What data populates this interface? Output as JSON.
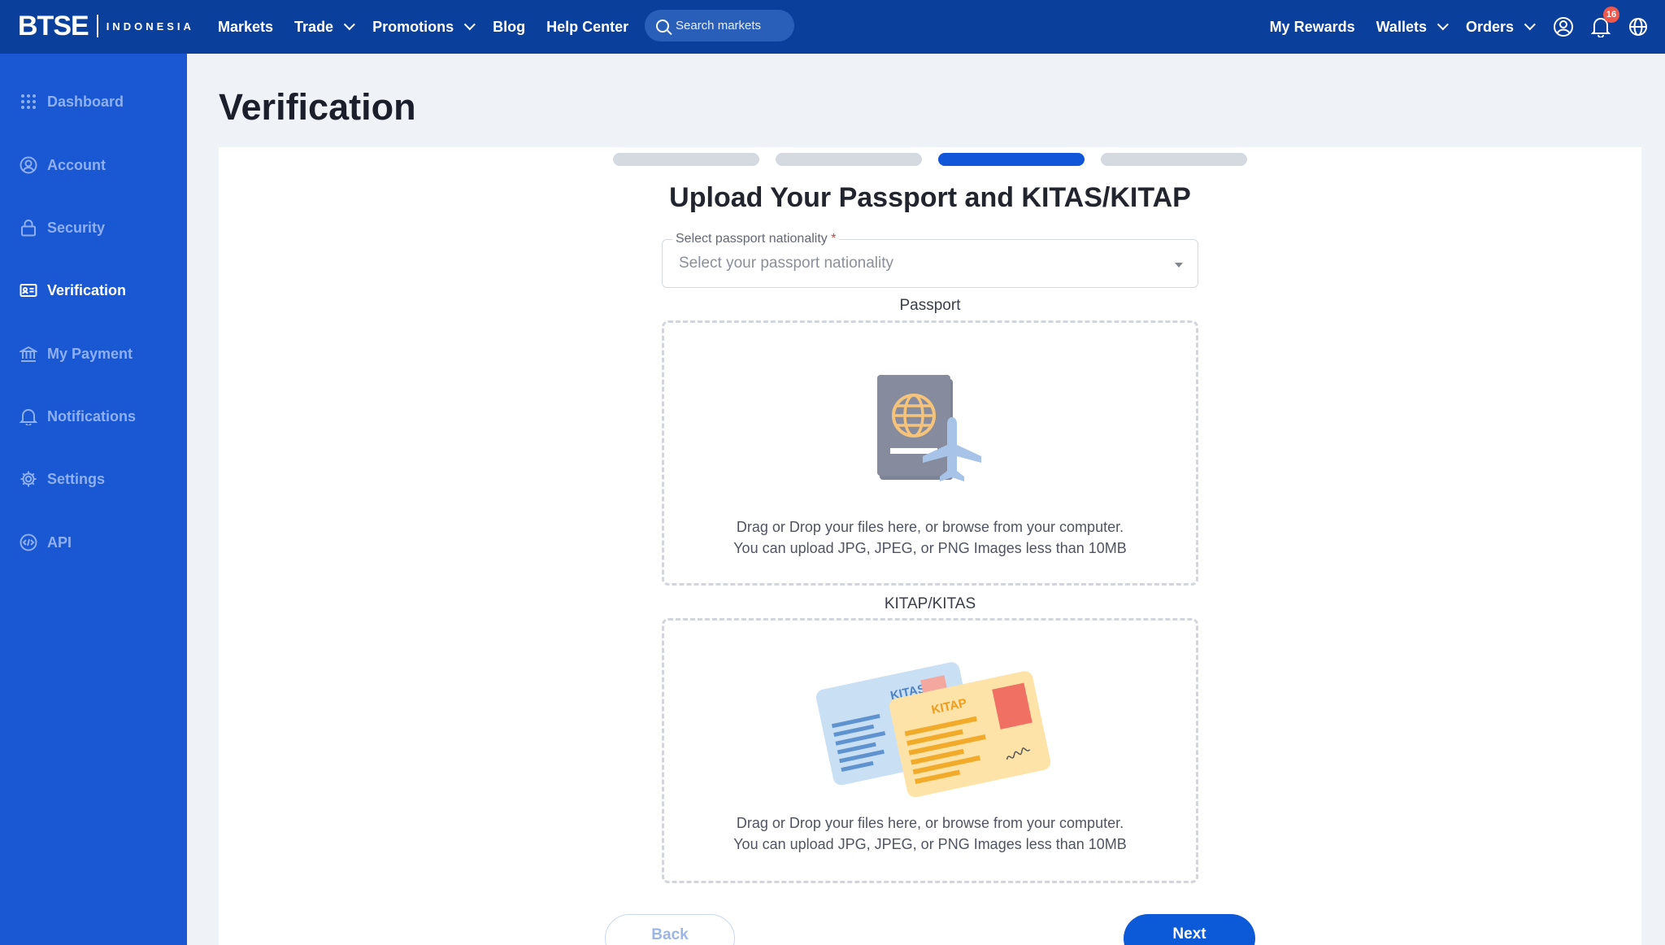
{
  "brand": {
    "name": "BTSE",
    "region": "INDONESIA"
  },
  "topnav": {
    "items": [
      {
        "label": "Markets",
        "has_caret": false
      },
      {
        "label": "Trade",
        "has_caret": true
      },
      {
        "label": "Promotions",
        "has_caret": true
      },
      {
        "label": "Blog",
        "has_caret": false
      },
      {
        "label": "Help Center",
        "has_caret": false
      }
    ],
    "search_placeholder": "Search markets",
    "right": {
      "rewards": "My Rewards",
      "wallets": "Wallets",
      "orders": "Orders",
      "notification_count": "16"
    }
  },
  "sidebar": {
    "items": [
      {
        "label": "Dashboard",
        "icon": "grid-icon",
        "active": false
      },
      {
        "label": "Account",
        "icon": "user-icon",
        "active": false
      },
      {
        "label": "Security",
        "icon": "lock-icon",
        "active": false
      },
      {
        "label": "Verification",
        "icon": "id-card-icon",
        "active": true
      },
      {
        "label": "My Payment",
        "icon": "bank-icon",
        "active": false
      },
      {
        "label": "Notifications",
        "icon": "bell-icon",
        "active": false
      },
      {
        "label": "Settings",
        "icon": "gear-icon",
        "active": false
      },
      {
        "label": "API",
        "icon": "code-icon",
        "active": false
      }
    ]
  },
  "main": {
    "page_title": "Verification",
    "progress": {
      "total_steps": 4,
      "current_step": 3
    },
    "heading": "Upload Your Passport and KITAS/KITAP",
    "nationality": {
      "label": "Select passport nationality",
      "required_mark": "*",
      "placeholder": "Select your passport nationality"
    },
    "passport": {
      "title": "Passport",
      "line1": "Drag or Drop your files here, or browse from your computer.",
      "line2": "You can upload JPG, JPEG, or PNG Images less than 10MB"
    },
    "kitas": {
      "title": "KITAP/KITAS",
      "card_back_label": "KITAS",
      "card_front_label": "KITAP",
      "line1": "Drag or Drop your files here, or browse from your computer.",
      "line2": "You can upload JPG, JPEG, or PNG Images less than 10MB"
    },
    "back_label": "Back",
    "next_label": "Next"
  },
  "colors": {
    "topbar": "#0a3f9c",
    "sidebar": "#1957d3",
    "accent": "#1155d9",
    "badge": "#f0584e"
  }
}
